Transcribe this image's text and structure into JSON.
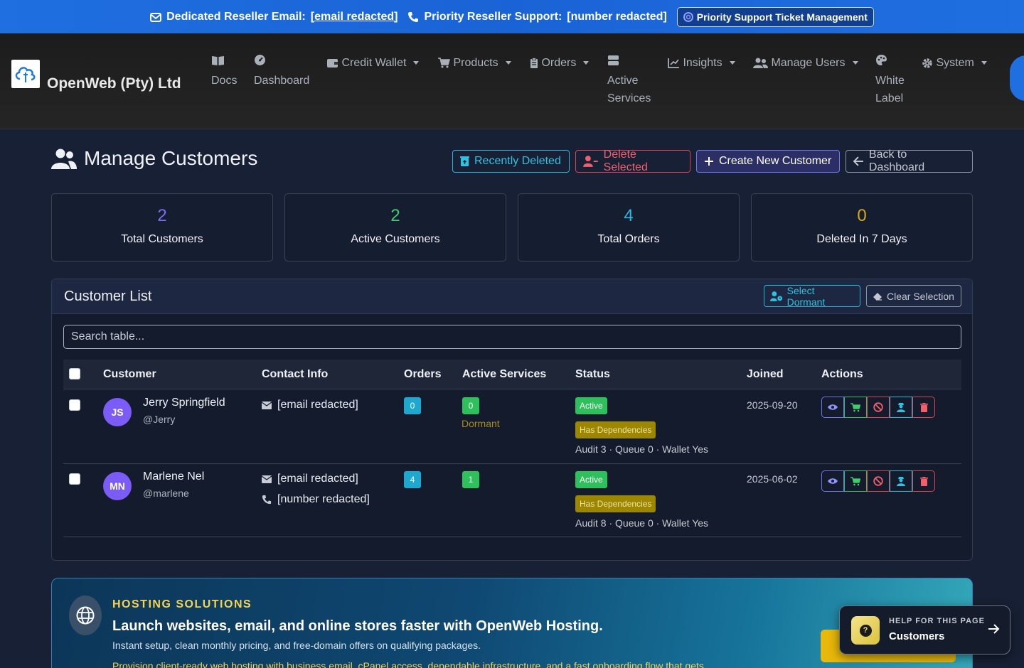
{
  "topbar": {
    "email_label": "Dedicated Reseller Email:",
    "email_value": "[email redacted]",
    "phone_label": "Priority Reseller Support:",
    "phone_value": "[number redacted]",
    "ticket_button": "Priority Support Ticket Management"
  },
  "brand": {
    "name": "OpenWeb (Pty) Ltd"
  },
  "nav": {
    "docs": "Docs",
    "dashboard": "Dashboard",
    "credit_wallet": "Credit Wallet",
    "products": "Products",
    "orders": "Orders",
    "active_services_1": "Active",
    "active_services_2": "Services",
    "insights": "Insights",
    "manage_users": "Manage Users",
    "white_label_1": "White",
    "white_label_2": "Label",
    "system": "System"
  },
  "header": {
    "title": "Manage Customers",
    "recently_deleted": "Recently Deleted",
    "delete_selected": "Delete Selected",
    "create_customer": "Create New Customer",
    "back_dashboard": "Back to Dashboard"
  },
  "stats": [
    {
      "value": "2",
      "label": "Total Customers",
      "color": "#7b6cf6"
    },
    {
      "value": "2",
      "label": "Active Customers",
      "color": "#3fcf6b"
    },
    {
      "value": "4",
      "label": "Total Orders",
      "color": "#2fb8dc"
    },
    {
      "value": "0",
      "label": "Deleted In 7 Days",
      "color": "#d8a911"
    }
  ],
  "list": {
    "title": "Customer List",
    "select_dormant": "Select Dormant",
    "clear_selection": "Clear Selection",
    "search_placeholder": "Search table...",
    "columns": {
      "customer": "Customer",
      "contact": "Contact Info",
      "orders": "Orders",
      "active_services": "Active Services",
      "status": "Status",
      "joined": "Joined",
      "actions": "Actions"
    },
    "rows": [
      {
        "initials": "JS",
        "name": "Jerry Springfield",
        "username": "@Jerry",
        "email": "[email redacted]",
        "orders": "0",
        "active_services": "0",
        "service_note": "Dormant",
        "status": "Active",
        "dependency": "Has Dependencies",
        "meta": "Audit 3 · Queue 0 · Wallet Yes",
        "joined": "2025-09-20"
      },
      {
        "initials": "MN",
        "name": "Marlene Nel",
        "username": "@marlene",
        "email": "[email redacted]",
        "phone": "[number redacted]",
        "orders": "4",
        "active_services": "1",
        "status": "Active",
        "dependency": "Has Dependencies",
        "meta": "Audit 8 · Queue 0 · Wallet Yes",
        "joined": "2025-06-02"
      }
    ]
  },
  "promo": {
    "kicker": "HOSTING SOLUTIONS",
    "title": "Launch websites, email, and online stores faster with OpenWeb Hosting.",
    "subtitle": "Instant setup, clean monthly pricing, and free-domain offers on qualifying packages.",
    "body": "Provision client-ready web hosting with business email, cPanel access, dependable infrastructure, and a fast onboarding flow that gets"
  },
  "help": {
    "kicker": "HELP FOR THIS PAGE",
    "title": "Customers"
  }
}
